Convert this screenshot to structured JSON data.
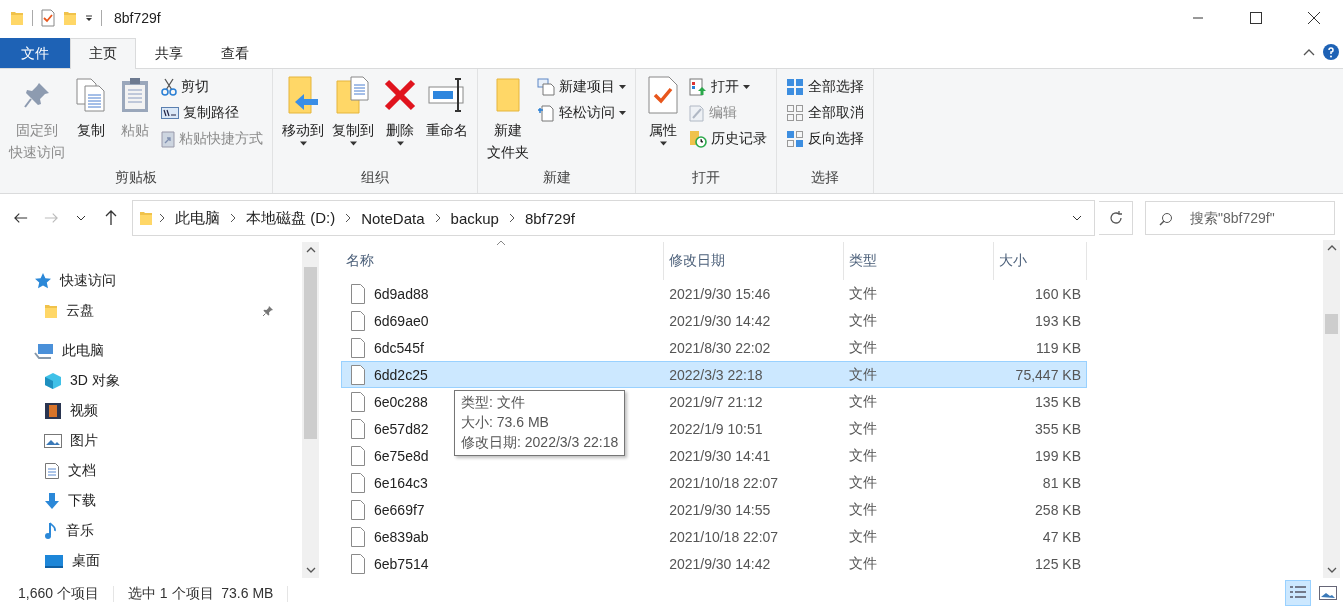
{
  "window": {
    "title": "8bf729f"
  },
  "ribbon_tabs": [
    {
      "label": "文件",
      "kind": "file",
      "selected": false
    },
    {
      "label": "主页",
      "kind": "tab",
      "selected": true
    },
    {
      "label": "共享",
      "kind": "tab",
      "selected": false
    },
    {
      "label": "查看",
      "kind": "tab",
      "selected": false
    }
  ],
  "ribbon_groups": [
    {
      "label": "剪贴板",
      "items": [
        {
          "label_lines": [
            "固定到",
            "快速访问"
          ],
          "kind": "large",
          "disabled": true,
          "dropdown": false
        },
        {
          "label": "复制",
          "kind": "large",
          "disabled": false,
          "dropdown": false
        },
        {
          "label": "粘贴",
          "kind": "large",
          "disabled": true,
          "dropdown": false
        },
        {
          "label": "剪切",
          "kind": "small",
          "disabled": false,
          "dropdown": false
        },
        {
          "label": "复制路径",
          "kind": "small",
          "disabled": false,
          "dropdown": false
        },
        {
          "label": "粘贴快捷方式",
          "kind": "small",
          "disabled": true,
          "dropdown": false
        }
      ]
    },
    {
      "label": "组织",
      "items": [
        {
          "label": "移动到",
          "kind": "large",
          "disabled": false,
          "dropdown": true
        },
        {
          "label": "复制到",
          "kind": "large",
          "disabled": false,
          "dropdown": true
        },
        {
          "label": "删除",
          "kind": "large",
          "disabled": false,
          "dropdown": true
        },
        {
          "label": "重命名",
          "kind": "large",
          "disabled": false,
          "dropdown": false
        }
      ]
    },
    {
      "label": "新建",
      "items": [
        {
          "label_lines": [
            "新建",
            "文件夹"
          ],
          "kind": "large",
          "disabled": false,
          "dropdown": false
        },
        {
          "label": "新建项目",
          "kind": "small",
          "disabled": false,
          "dropdown": true
        },
        {
          "label": "轻松访问",
          "kind": "small",
          "disabled": false,
          "dropdown": true
        }
      ]
    },
    {
      "label": "打开",
      "items": [
        {
          "label": "属性",
          "kind": "large",
          "disabled": false,
          "dropdown": true
        },
        {
          "label": "打开",
          "kind": "small",
          "disabled": false,
          "dropdown": true
        },
        {
          "label": "编辑",
          "kind": "small",
          "disabled": true,
          "dropdown": false
        },
        {
          "label": "历史记录",
          "kind": "small",
          "disabled": false,
          "dropdown": false
        }
      ]
    },
    {
      "label": "选择",
      "items": [
        {
          "label": "全部选择",
          "kind": "small",
          "disabled": false,
          "dropdown": false
        },
        {
          "label": "全部取消",
          "kind": "small",
          "disabled": false,
          "dropdown": false
        },
        {
          "label": "反向选择",
          "kind": "small",
          "disabled": false,
          "dropdown": false
        }
      ]
    }
  ],
  "address": {
    "path": [
      "此电脑",
      "本地磁盘 (D:)",
      "NoteData",
      "backup",
      "8bf729f"
    ]
  },
  "search": {
    "placeholder": "搜索\"8bf729f\""
  },
  "sidebar": {
    "items": [
      {
        "label": "快速访问",
        "children": [
          {
            "label": "云盘",
            "pinned": true
          }
        ]
      },
      {
        "label": "此电脑",
        "children": [
          {
            "label": "3D 对象",
            "pinned": false
          },
          {
            "label": "视频",
            "pinned": false
          },
          {
            "label": "图片",
            "pinned": false
          },
          {
            "label": "文档",
            "pinned": false
          },
          {
            "label": "下载",
            "pinned": false
          },
          {
            "label": "音乐",
            "pinned": false
          },
          {
            "label": "桌面",
            "pinned": false
          }
        ]
      }
    ]
  },
  "table": {
    "columns": [
      "名称",
      "修改日期",
      "类型",
      "大小"
    ],
    "rows": [
      {
        "name": "6d9ad88",
        "modified": "2021/9/30 15:46",
        "type": "文件",
        "size": "160 KB",
        "selected": false
      },
      {
        "name": "6d69ae0",
        "modified": "2021/9/30 14:42",
        "type": "文件",
        "size": "193 KB",
        "selected": false
      },
      {
        "name": "6dc545f",
        "modified": "2021/8/30 22:02",
        "type": "文件",
        "size": "119 KB",
        "selected": false
      },
      {
        "name": "6dd2c25",
        "modified": "2022/3/3 22:18",
        "type": "文件",
        "size": "75,447 KB",
        "selected": true
      },
      {
        "name": "6e0c288",
        "modified": "2021/9/7 21:12",
        "type": "文件",
        "size": "135 KB",
        "selected": false
      },
      {
        "name": "6e57d82",
        "modified": "2022/1/9 10:51",
        "type": "文件",
        "size": "355 KB",
        "selected": false
      },
      {
        "name": "6e75e8d",
        "modified": "2021/9/30 14:41",
        "type": "文件",
        "size": "199 KB",
        "selected": false
      },
      {
        "name": "6e164c3",
        "modified": "2021/10/18 22:07",
        "type": "文件",
        "size": "81 KB",
        "selected": false
      },
      {
        "name": "6e669f7",
        "modified": "2021/9/30 14:55",
        "type": "文件",
        "size": "258 KB",
        "selected": false
      },
      {
        "name": "6e839ab",
        "modified": "2021/10/18 22:07",
        "type": "文件",
        "size": "47 KB",
        "selected": false
      },
      {
        "name": "6eb7514",
        "modified": "2021/9/30 14:42",
        "type": "文件",
        "size": "125 KB",
        "selected": false
      }
    ]
  },
  "tooltip": {
    "lines": [
      "类型: 文件",
      "大小: 73.6 MB",
      "修改日期: 2022/3/3 22:18"
    ]
  },
  "status_bar": {
    "count": "1,660 个项目",
    "selection": "选中 1 个项目  73.6 MB"
  },
  "view_buttons": [
    {
      "selected": true
    },
    {
      "selected": false
    }
  ]
}
